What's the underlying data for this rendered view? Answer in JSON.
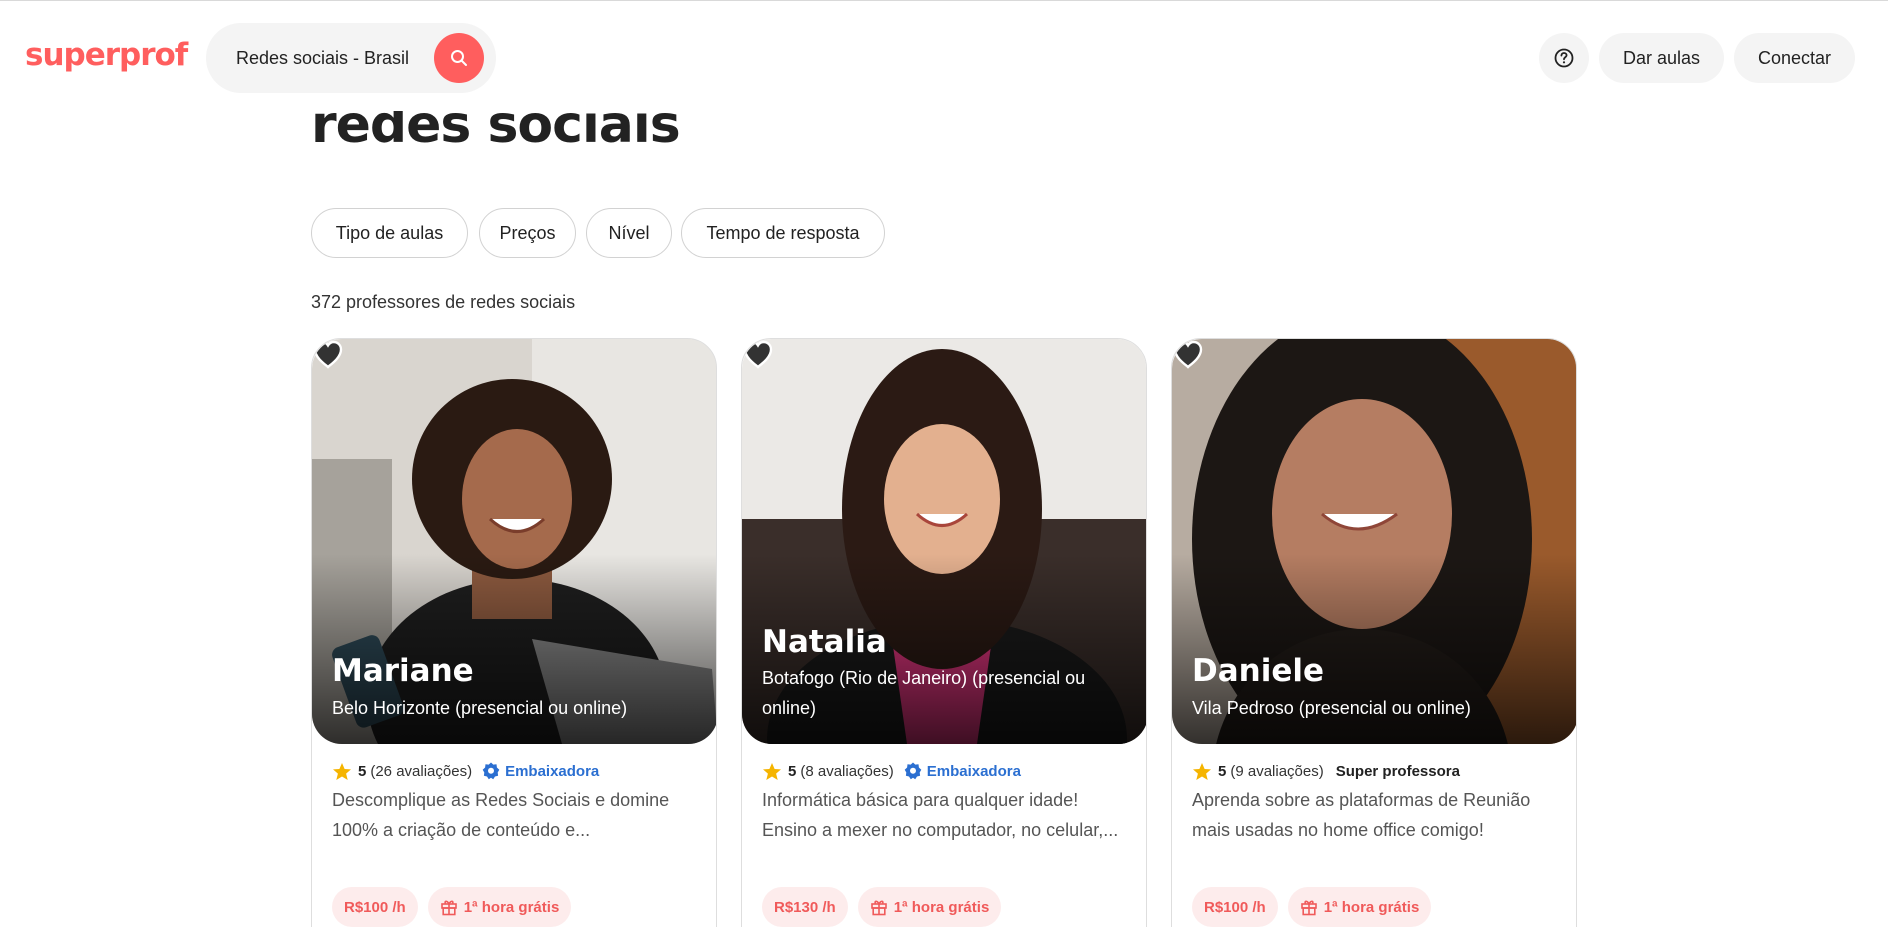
{
  "header": {
    "logo": "superprof",
    "search_value": "Redes sociais - Brasil",
    "search_icon": "search-icon",
    "help_icon": "help-circle-icon",
    "teach_label": "Dar aulas",
    "login_label": "Conectar"
  },
  "main": {
    "title": "redes sociais",
    "filters": [
      "Tipo de aulas",
      "Preços",
      "Nível",
      "Tempo de resposta"
    ],
    "result_count": "372 professores de redes sociais"
  },
  "teachers": [
    {
      "name": "Mariane",
      "location": "Belo Horizonte (presencial ou online)",
      "score": "5",
      "reviews": "(26 avaliações)",
      "badge": "Embaixadora",
      "badge_type": "ambassador",
      "description": "Descomplique as Redes Sociais e domine 100% a criação de conteúdo e...",
      "price": "R$100 /h",
      "free_hour": "1ª hora grátis"
    },
    {
      "name": "Natalia",
      "location": "Botafogo (Rio de Janeiro) (presencial ou online)",
      "score": "5",
      "reviews": "(8 avaliações)",
      "badge": "Embaixadora",
      "badge_type": "ambassador",
      "description": "Informática básica para qualquer idade! Ensino a mexer no computador, no celular,...",
      "price": "R$130 /h",
      "free_hour": "1ª hora grátis"
    },
    {
      "name": "Daniele",
      "location": "Vila Pedroso (presencial ou online)",
      "score": "5",
      "reviews": "(9 avaliações)",
      "badge": "Super professora",
      "badge_type": "super",
      "description": "Aprenda sobre as plataformas de Reunião mais usadas no home office comigo!",
      "price": "R$100 /h",
      "free_hour": "1ª hora grátis"
    }
  ],
  "colors": {
    "brand": "#ff5e5e",
    "ambassador": "#2b6fd1",
    "star": "#f5b400",
    "tag_bg": "#fdecec"
  }
}
